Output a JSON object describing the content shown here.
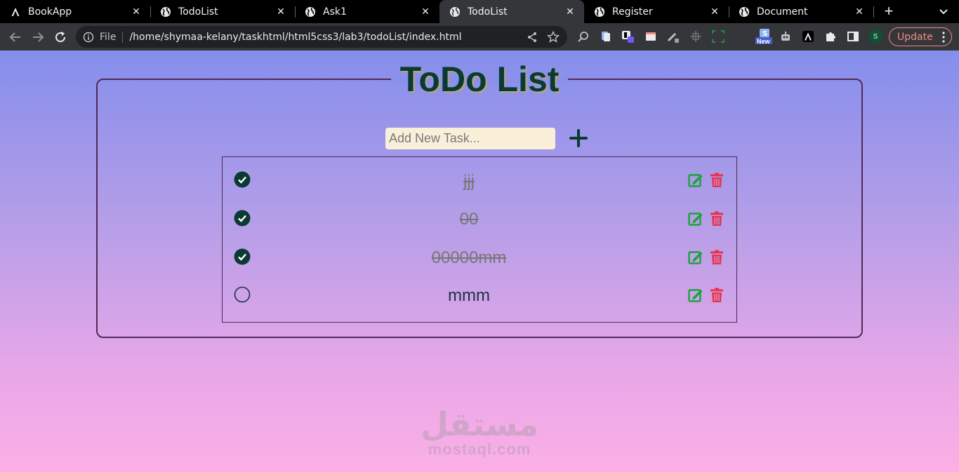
{
  "browser": {
    "tabs": [
      {
        "title": "BookApp",
        "icon": "letter-a-icon",
        "active": false
      },
      {
        "title": "TodoList",
        "icon": "globe-icon",
        "active": false
      },
      {
        "title": "Ask1",
        "icon": "globe-icon",
        "active": false
      },
      {
        "title": "TodoList",
        "icon": "globe-icon",
        "active": true
      },
      {
        "title": "Register",
        "icon": "globe-icon",
        "active": false
      },
      {
        "title": "Document",
        "icon": "globe-icon",
        "active": false
      }
    ],
    "tab_close": "✕",
    "new_tab": "+",
    "address": {
      "scheme": "File",
      "url": "/home/shymaa-kelany/taskhtml/html5css3/lab3/todoList/index.html"
    },
    "profile_initial": "S",
    "update_label": "Update",
    "extension_badge": "New",
    "colors": {
      "chrome_bg": "#35363a",
      "tabbar_bg": "#000000",
      "update": "#f28b82"
    }
  },
  "app": {
    "title": "ToDo List",
    "input_placeholder": "Add New Task...",
    "input_value": "",
    "add_icon": "plus-icon",
    "tasks": [
      {
        "text": "jjj",
        "done": true
      },
      {
        "text": "00",
        "done": true
      },
      {
        "text": "00000mm",
        "done": true
      },
      {
        "text": "mmm",
        "done": false
      }
    ],
    "colors": {
      "title": "#0a3a34",
      "check": "#0a3a34",
      "edit": "#1aa33a",
      "delete": "#e8334e",
      "input_bg": "#faefd9"
    }
  },
  "watermark": {
    "arabic": "مستقل",
    "latin": "mostaql.com"
  }
}
